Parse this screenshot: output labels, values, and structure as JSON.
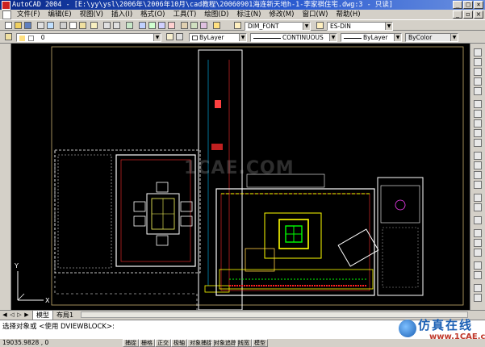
{
  "window": {
    "title": "AutoCAD 2004 - [E:\\yy\\ysl\\2006年\\2006年10月\\cad教程\\20060901海连新天地h-1-李家祺住宅.dwg:3 - 只读]",
    "buttons": [
      "minimize-icon",
      "maximize-icon",
      "close-icon"
    ]
  },
  "menubar": {
    "items": [
      "文件(F)",
      "编辑(E)",
      "视图(V)",
      "插入(I)",
      "格式(O)",
      "工具(T)",
      "绘图(D)",
      "标注(N)",
      "修改(M)",
      "窗口(W)",
      "帮助(H)"
    ]
  },
  "toolbar": {
    "text_style": "DIM_FONT",
    "dim_style": "ES-DIN",
    "layer_value": "0",
    "color_value": "ByLayer",
    "linetype_value": "CONTINUOUS",
    "lineweight_value": "ByLayer",
    "plotstyle_value": "ByColor"
  },
  "canvas": {
    "watermark": "1CAE.COM",
    "background": "#000000",
    "axis_label_x": "X",
    "axis_label_y": "Y"
  },
  "tabs": {
    "items": [
      "模型",
      "布局1"
    ],
    "active": 0
  },
  "command": {
    "line1": "选择对象或 <使用 DVIEWBLOCK>:",
    "line2": ""
  },
  "status": {
    "coords": "19035.9828 , 0",
    "buttons": [
      "捕捉",
      "栅格",
      "正交",
      "极轴",
      "对象捕捉",
      "对象追踪",
      "线宽",
      "模型"
    ]
  },
  "logo": {
    "main": "仿真在线",
    "sub": "www.1CAE.com"
  },
  "colors": {
    "wall": "#ffffff",
    "furniture": "#ffff00",
    "hatch": "#00ff00",
    "dim": "#ff2020",
    "outline": "#ffcc66",
    "accent": "#ff00ff"
  }
}
